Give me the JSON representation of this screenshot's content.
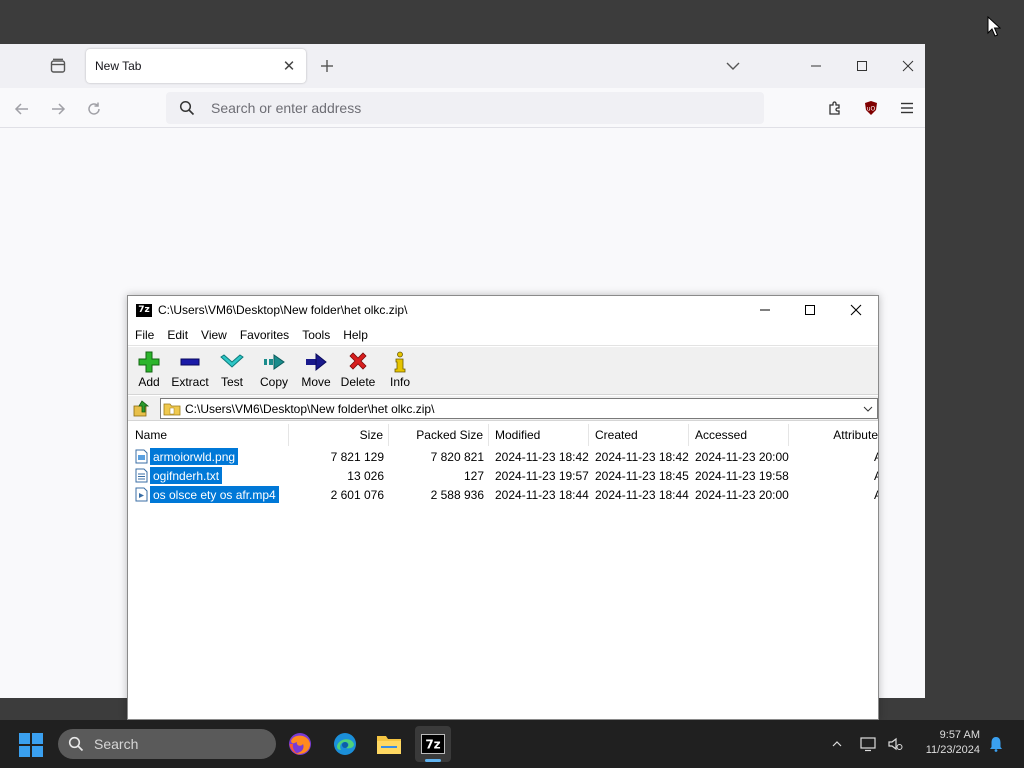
{
  "browser": {
    "tab_title": "New Tab",
    "url_placeholder": "Search or enter address"
  },
  "zip": {
    "window_title": "C:\\Users\\VM6\\Desktop\\New folder\\het olkc.zip\\",
    "menu": [
      "File",
      "Edit",
      "View",
      "Favorites",
      "Tools",
      "Help"
    ],
    "toolbar": [
      {
        "label": "Add",
        "icon": "plus-icon"
      },
      {
        "label": "Extract",
        "icon": "minus-icon"
      },
      {
        "label": "Test",
        "icon": "check-icon"
      },
      {
        "label": "Copy",
        "icon": "copy-arrow-icon"
      },
      {
        "label": "Move",
        "icon": "move-arrow-icon"
      },
      {
        "label": "Delete",
        "icon": "delete-x-icon"
      },
      {
        "label": "Info",
        "icon": "info-icon"
      }
    ],
    "path": "C:\\Users\\VM6\\Desktop\\New folder\\het olkc.zip\\",
    "columns": [
      "Name",
      "Size",
      "Packed Size",
      "Modified",
      "Created",
      "Accessed",
      "Attribute"
    ],
    "files": [
      {
        "name": "armoiorwld.png",
        "size": "7 821 129",
        "packed": "7 820 821",
        "modified": "2024-11-23 18:42",
        "created": "2024-11-23 18:42",
        "accessed": "2024-11-23 20:00",
        "attr": "A",
        "icon": "image-file-icon"
      },
      {
        "name": "ogifnderh.txt",
        "size": "13 026",
        "packed": "127",
        "modified": "2024-11-23 19:57",
        "created": "2024-11-23 18:45",
        "accessed": "2024-11-23 19:58",
        "attr": "A",
        "icon": "text-file-icon"
      },
      {
        "name": "os olsce ety os afr.mp4",
        "size": "2 601 076",
        "packed": "2 588 936",
        "modified": "2024-11-23 18:44",
        "created": "2024-11-23 18:44",
        "accessed": "2024-11-23 20:00",
        "attr": "A",
        "icon": "video-file-icon"
      }
    ]
  },
  "taskbar": {
    "search_label": "Search",
    "time": "9:57 AM",
    "date": "11/23/2024",
    "apps": [
      "firefox-icon",
      "edge-icon",
      "file-explorer-icon",
      "7zip-icon"
    ]
  },
  "colors": {
    "selection": "#0078d7",
    "taskbar": "#202020",
    "desktop": "#3c3c3c"
  }
}
